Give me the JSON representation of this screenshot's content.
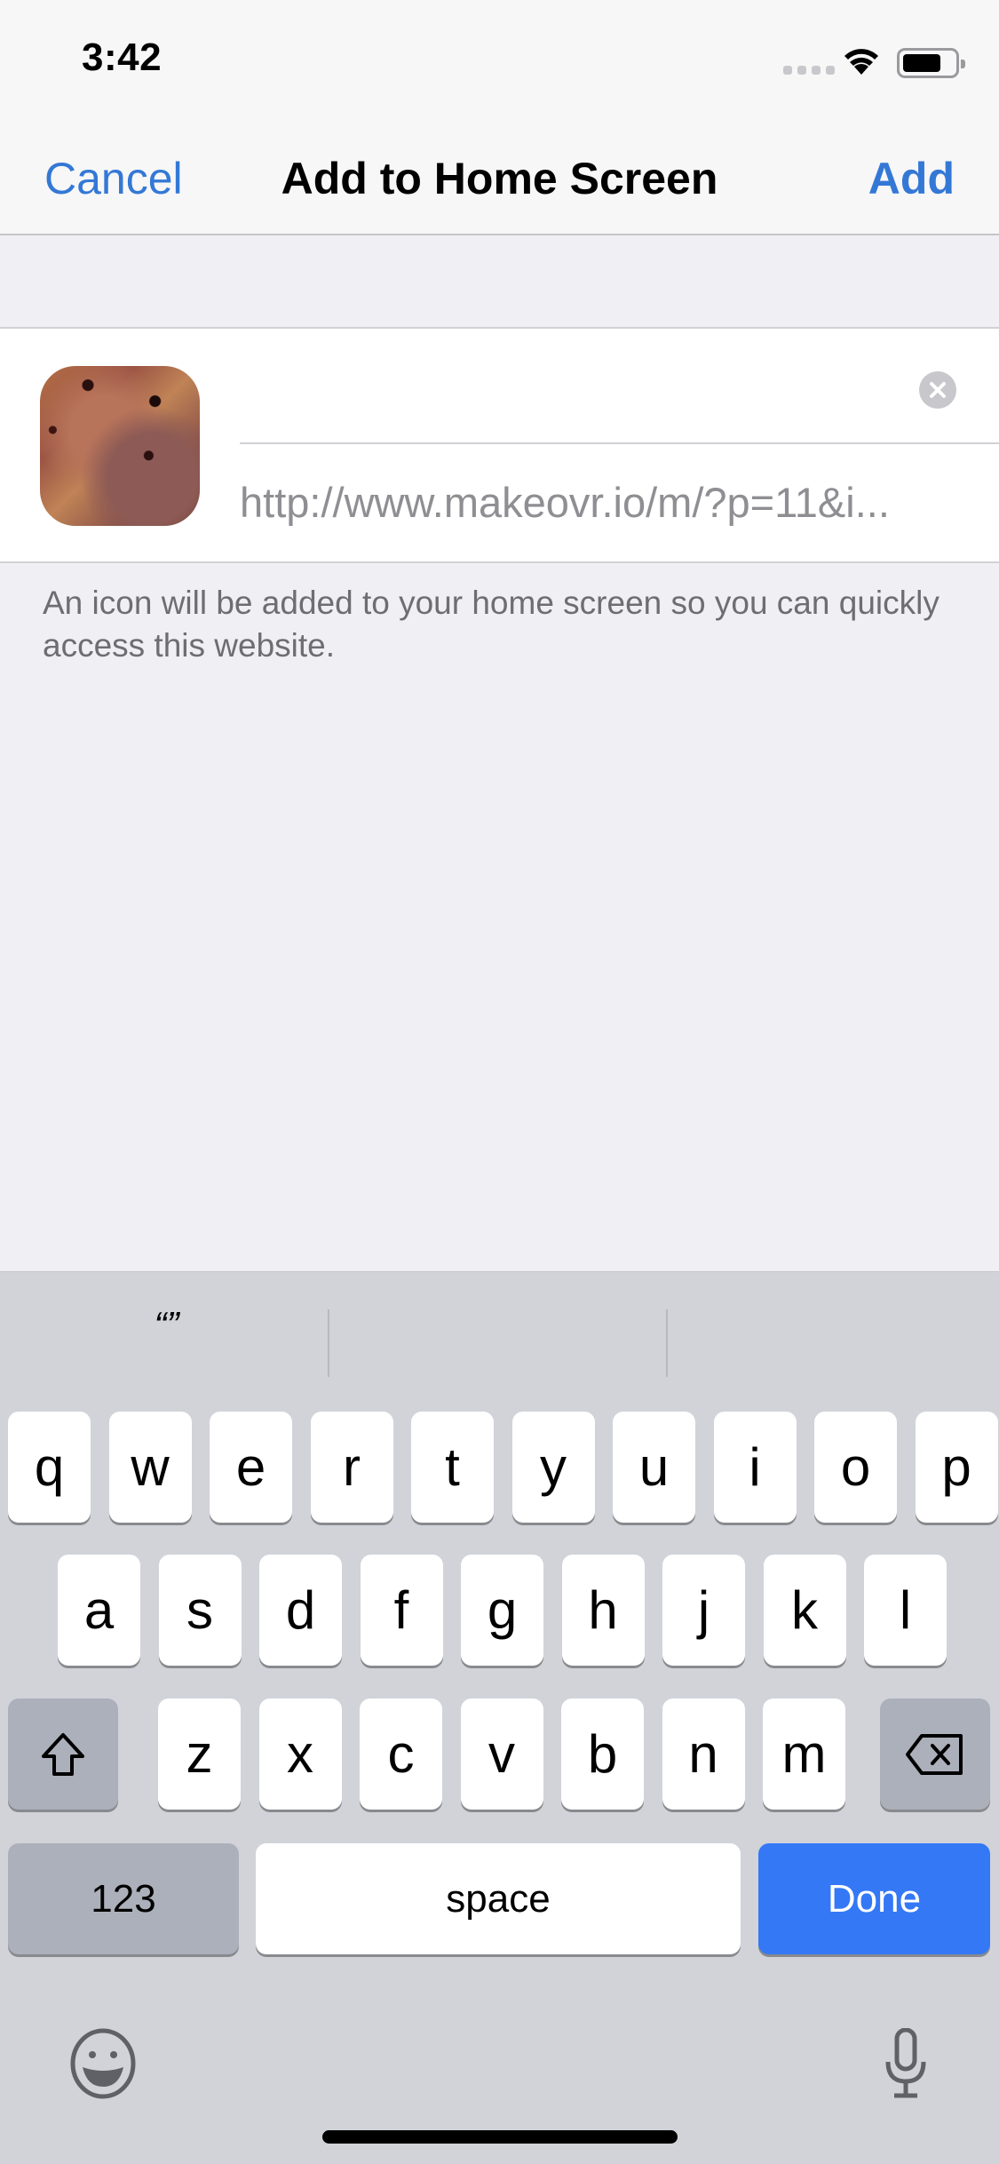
{
  "status_bar": {
    "time": "3:42",
    "signal_icon": "cellular-signal-icon",
    "wifi_icon": "wifi-icon",
    "battery_icon": "battery-icon",
    "battery_level": 0.75
  },
  "nav": {
    "cancel_label": "Cancel",
    "title": "Add to Home Screen",
    "add_label": "Add"
  },
  "bookmark": {
    "icon": "site-thumbnail",
    "title_value": "",
    "clear_icon": "clear-text-icon",
    "url": "http://www.makeovr.io/m/?p=11&i..."
  },
  "description": "An icon will be added to your home screen so you can quickly access this website.",
  "keyboard": {
    "suggestions": [
      "“”",
      "",
      ""
    ],
    "row1": [
      "q",
      "w",
      "e",
      "r",
      "t",
      "y",
      "u",
      "i",
      "o",
      "p"
    ],
    "row2": [
      "a",
      "s",
      "d",
      "f",
      "g",
      "h",
      "j",
      "k",
      "l"
    ],
    "row3": [
      "z",
      "x",
      "c",
      "v",
      "b",
      "n",
      "m"
    ],
    "shift_icon": "shift-icon",
    "delete_icon": "delete-icon",
    "numbers_label": "123",
    "space_label": "space",
    "done_label": "Done",
    "emoji_icon": "emoji-icon",
    "mic_icon": "microphone-icon",
    "colors": {
      "done": "#3478f6",
      "accent": "#3478d6"
    }
  }
}
